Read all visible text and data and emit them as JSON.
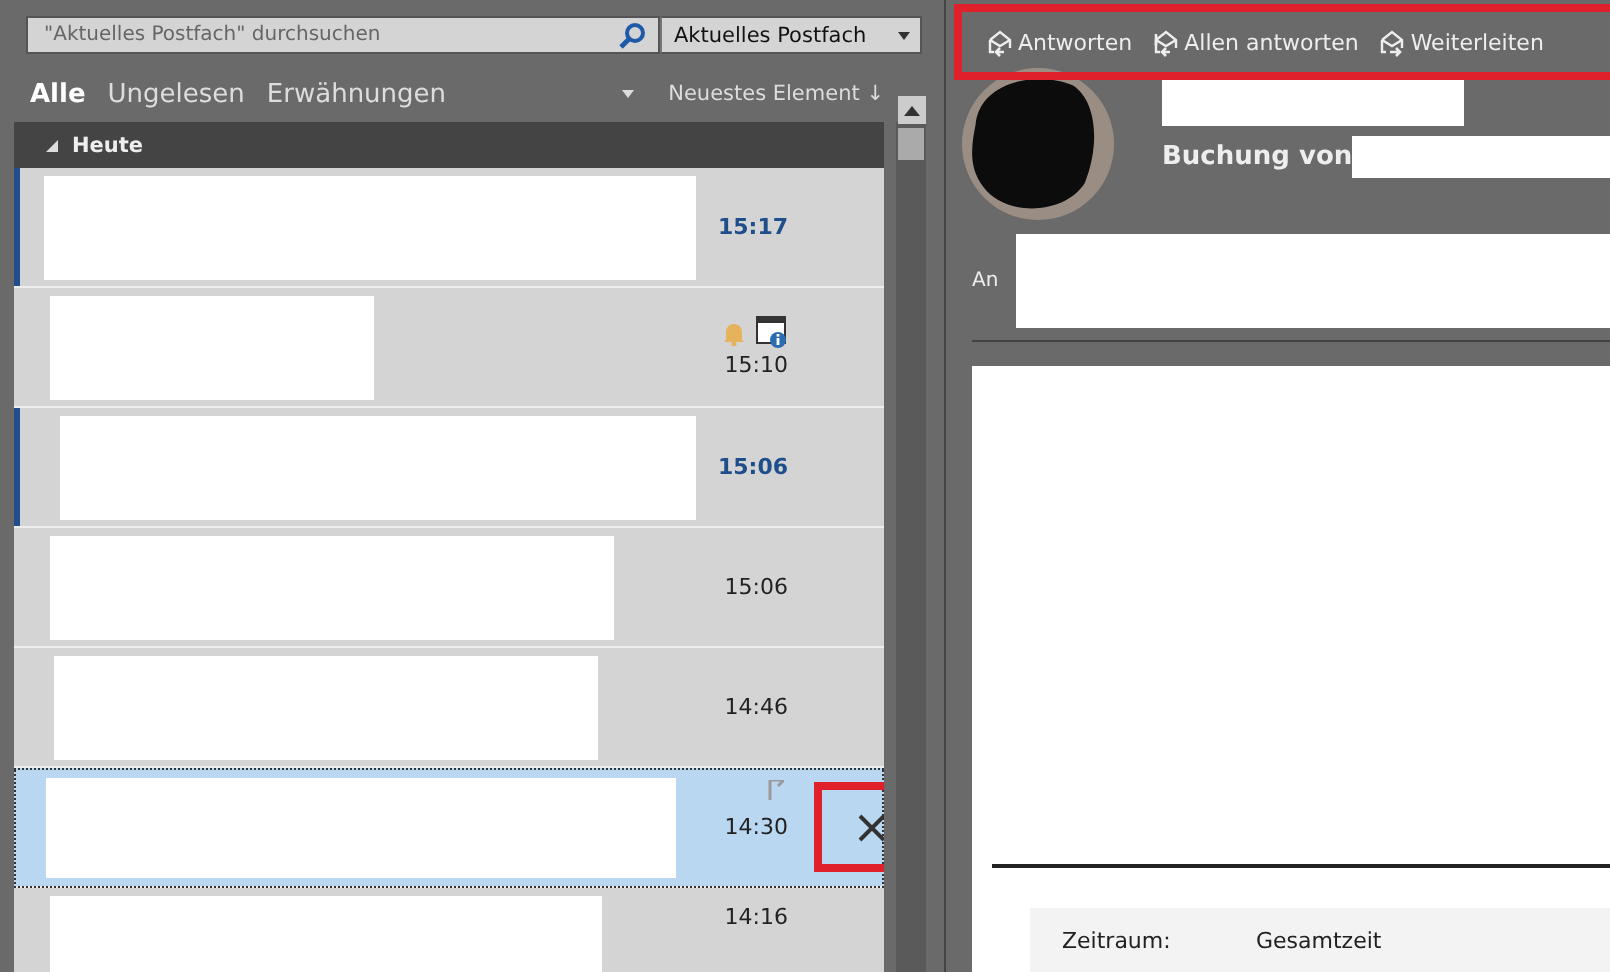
{
  "search": {
    "placeholder": "\"Aktuelles Postfach\" durchsuchen",
    "scope": "Aktuelles Postfach"
  },
  "filters": [
    {
      "label": "Alle",
      "selected": true
    },
    {
      "label": "Ungelesen",
      "selected": false
    },
    {
      "label": "Erwähnungen",
      "selected": false
    }
  ],
  "sort": {
    "label": "Neuestes Element ↓"
  },
  "group": {
    "label": "Heute",
    "expanded": true
  },
  "messages": [
    {
      "time": "15:17",
      "unread": true,
      "selected": false,
      "reminder": false
    },
    {
      "time": "15:10",
      "unread": false,
      "selected": false,
      "reminder": true
    },
    {
      "time": "15:06",
      "unread": true,
      "selected": false,
      "reminder": false
    },
    {
      "time": "15:06",
      "unread": false,
      "selected": false,
      "reminder": false
    },
    {
      "time": "14:46",
      "unread": false,
      "selected": false,
      "reminder": false
    },
    {
      "time": "14:30",
      "unread": false,
      "selected": true,
      "reminder": false,
      "annotated": true
    },
    {
      "time": "14:16",
      "unread": false,
      "selected": false,
      "reminder": false
    }
  ],
  "toolbar": {
    "annotated": true,
    "actions": [
      {
        "label": "Antworten",
        "kind": "reply"
      },
      {
        "label": "Allen antworten",
        "kind": "replyall"
      },
      {
        "label": "Weiterleiten",
        "kind": "forward"
      }
    ]
  },
  "reading": {
    "subject": "Buchung von",
    "to_label": "An",
    "fields": [
      {
        "label": "Zeitraum:",
        "value": "Gesamtzeit"
      }
    ]
  }
}
